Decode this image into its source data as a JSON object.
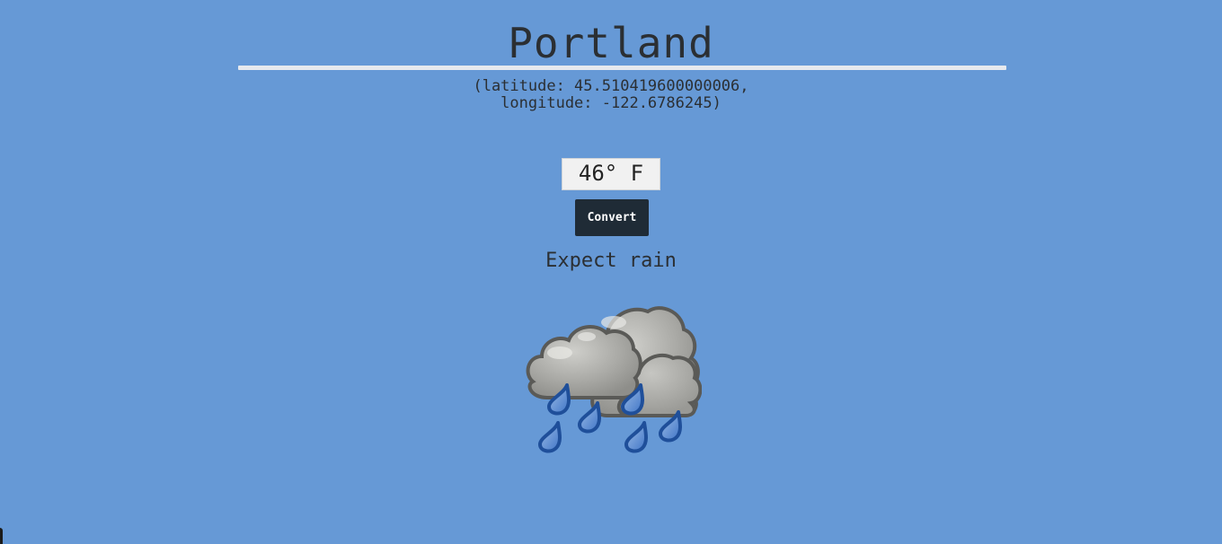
{
  "location": {
    "city": "Portland",
    "coords_line1": "(latitude: 45.510419600000006,",
    "coords_line2": "longitude: -122.6786245)"
  },
  "weather": {
    "temperature": "46° F",
    "convert_label": "Convert",
    "forecast": "Expect rain",
    "icon": "rain-clouds-icon"
  },
  "colors": {
    "background": "#6699d6",
    "button": "#1f2b36",
    "rain": "#1f4f9a"
  }
}
